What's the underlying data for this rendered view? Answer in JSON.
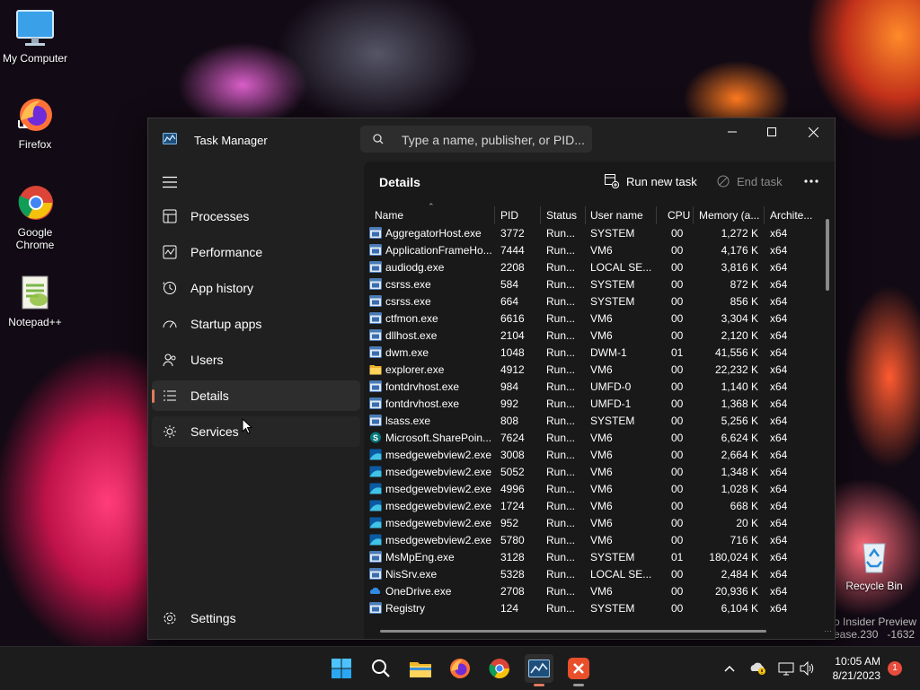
{
  "desktop": {
    "icons": [
      {
        "label": "My Computer"
      },
      {
        "label": "Firefox"
      },
      {
        "label": "Google Chrome"
      },
      {
        "label": "Notepad++"
      },
      {
        "label": "Recycle Bin"
      }
    ],
    "watermark_line1": "o Insider Preview",
    "watermark_line2": "ease.230",
    "watermark_line3": "-1632"
  },
  "window": {
    "title": "Task Manager",
    "search_placeholder": "Type a name, publisher, or PID..."
  },
  "sidebar": {
    "items": [
      {
        "label": "Processes",
        "icon": "processes-icon"
      },
      {
        "label": "Performance",
        "icon": "performance-icon"
      },
      {
        "label": "App history",
        "icon": "app-history-icon"
      },
      {
        "label": "Startup apps",
        "icon": "startup-apps-icon"
      },
      {
        "label": "Users",
        "icon": "users-icon"
      },
      {
        "label": "Details",
        "icon": "details-icon",
        "active": true
      },
      {
        "label": "Services",
        "icon": "services-icon"
      }
    ],
    "settings_label": "Settings"
  },
  "main": {
    "title": "Details",
    "run_new_task": "Run new task",
    "end_task": "End task",
    "columns": [
      "Name",
      "PID",
      "Status",
      "User name",
      "CPU",
      "Memory (a...",
      "Archite..."
    ],
    "rows": [
      {
        "name": "AggregatorHost.exe",
        "pid": "3772",
        "status": "Run...",
        "user": "SYSTEM",
        "cpu": "00",
        "mem": "1,272 K",
        "arch": "x64",
        "icon": "generic"
      },
      {
        "name": "ApplicationFrameHo...",
        "pid": "7444",
        "status": "Run...",
        "user": "VM6",
        "cpu": "00",
        "mem": "4,176 K",
        "arch": "x64",
        "icon": "generic"
      },
      {
        "name": "audiodg.exe",
        "pid": "2208",
        "status": "Run...",
        "user": "LOCAL SE...",
        "cpu": "00",
        "mem": "3,816 K",
        "arch": "x64",
        "icon": "generic"
      },
      {
        "name": "csrss.exe",
        "pid": "584",
        "status": "Run...",
        "user": "SYSTEM",
        "cpu": "00",
        "mem": "872 K",
        "arch": "x64",
        "icon": "generic"
      },
      {
        "name": "csrss.exe",
        "pid": "664",
        "status": "Run...",
        "user": "SYSTEM",
        "cpu": "00",
        "mem": "856 K",
        "arch": "x64",
        "icon": "generic"
      },
      {
        "name": "ctfmon.exe",
        "pid": "6616",
        "status": "Run...",
        "user": "VM6",
        "cpu": "00",
        "mem": "3,304 K",
        "arch": "x64",
        "icon": "generic"
      },
      {
        "name": "dllhost.exe",
        "pid": "2104",
        "status": "Run...",
        "user": "VM6",
        "cpu": "00",
        "mem": "2,120 K",
        "arch": "x64",
        "icon": "generic"
      },
      {
        "name": "dwm.exe",
        "pid": "1048",
        "status": "Run...",
        "user": "DWM-1",
        "cpu": "01",
        "mem": "41,556 K",
        "arch": "x64",
        "icon": "generic"
      },
      {
        "name": "explorer.exe",
        "pid": "4912",
        "status": "Run...",
        "user": "VM6",
        "cpu": "00",
        "mem": "22,232 K",
        "arch": "x64",
        "icon": "folder"
      },
      {
        "name": "fontdrvhost.exe",
        "pid": "984",
        "status": "Run...",
        "user": "UMFD-0",
        "cpu": "00",
        "mem": "1,140 K",
        "arch": "x64",
        "icon": "generic"
      },
      {
        "name": "fontdrvhost.exe",
        "pid": "992",
        "status": "Run...",
        "user": "UMFD-1",
        "cpu": "00",
        "mem": "1,368 K",
        "arch": "x64",
        "icon": "generic"
      },
      {
        "name": "lsass.exe",
        "pid": "808",
        "status": "Run...",
        "user": "SYSTEM",
        "cpu": "00",
        "mem": "5,256 K",
        "arch": "x64",
        "icon": "generic"
      },
      {
        "name": "Microsoft.SharePoin...",
        "pid": "7624",
        "status": "Run...",
        "user": "VM6",
        "cpu": "00",
        "mem": "6,624 K",
        "arch": "x64",
        "icon": "sharepoint"
      },
      {
        "name": "msedgewebview2.exe",
        "pid": "3008",
        "status": "Run...",
        "user": "VM6",
        "cpu": "00",
        "mem": "2,664 K",
        "arch": "x64",
        "icon": "webview"
      },
      {
        "name": "msedgewebview2.exe",
        "pid": "5052",
        "status": "Run...",
        "user": "VM6",
        "cpu": "00",
        "mem": "1,348 K",
        "arch": "x64",
        "icon": "webview"
      },
      {
        "name": "msedgewebview2.exe",
        "pid": "4996",
        "status": "Run...",
        "user": "VM6",
        "cpu": "00",
        "mem": "1,028 K",
        "arch": "x64",
        "icon": "webview"
      },
      {
        "name": "msedgewebview2.exe",
        "pid": "1724",
        "status": "Run...",
        "user": "VM6",
        "cpu": "00",
        "mem": "668 K",
        "arch": "x64",
        "icon": "webview"
      },
      {
        "name": "msedgewebview2.exe",
        "pid": "952",
        "status": "Run...",
        "user": "VM6",
        "cpu": "00",
        "mem": "20 K",
        "arch": "x64",
        "icon": "webview"
      },
      {
        "name": "msedgewebview2.exe",
        "pid": "5780",
        "status": "Run...",
        "user": "VM6",
        "cpu": "00",
        "mem": "716 K",
        "arch": "x64",
        "icon": "webview"
      },
      {
        "name": "MsMpEng.exe",
        "pid": "3128",
        "status": "Run...",
        "user": "SYSTEM",
        "cpu": "01",
        "mem": "180,024 K",
        "arch": "x64",
        "icon": "generic"
      },
      {
        "name": "NisSrv.exe",
        "pid": "5328",
        "status": "Run...",
        "user": "LOCAL SE...",
        "cpu": "00",
        "mem": "2,484 K",
        "arch": "x64",
        "icon": "generic"
      },
      {
        "name": "OneDrive.exe",
        "pid": "2708",
        "status": "Run...",
        "user": "VM6",
        "cpu": "00",
        "mem": "20,936 K",
        "arch": "x64",
        "icon": "onedrive"
      },
      {
        "name": "Registry",
        "pid": "124",
        "status": "Run...",
        "user": "SYSTEM",
        "cpu": "00",
        "mem": "6,104 K",
        "arch": "x64",
        "icon": "generic"
      }
    ]
  },
  "taskbar": {
    "time": "10:05 AM",
    "date": "8/21/2023",
    "notification_count": "1"
  },
  "colors": {
    "accent": "#e07a5f",
    "window_bg": "#202020",
    "content_bg": "#191919"
  }
}
